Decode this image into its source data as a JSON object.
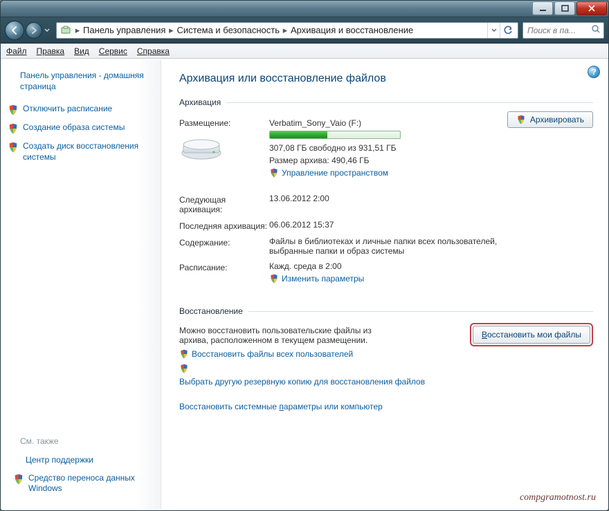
{
  "breadcrumbs": {
    "b0": "Панель управления",
    "b1": "Система и безопасность",
    "b2": "Архивация и восстановление"
  },
  "search": {
    "placeholder": "Поиск в па..."
  },
  "menu": {
    "file": "Файл",
    "edit": "Правка",
    "view": "Вид",
    "tools": "Сервис",
    "help": "Справка"
  },
  "sidebar": {
    "home": "Панель управления - домашняя страница",
    "disable_schedule": "Отключить расписание",
    "create_image": "Создание образа системы",
    "create_repair": "Создать диск восстановления системы",
    "also": "См. также",
    "support": "Центр поддержки",
    "wet": "Средство переноса данных Windows"
  },
  "main": {
    "title": "Архивация или восстановление файлов",
    "backup_section": "Архивация",
    "loc_label": "Размещение:",
    "loc_value": "Verbatim_Sony_Vaio (F:)",
    "free_space": "307,08 ГБ свободно из 931,51 ГБ",
    "archive_size": "Размер архива: 490,46 ГБ",
    "manage_space": "Управление пространством",
    "backup_btn": "Архивировать",
    "next_label": "Следующая архивация:",
    "next_value": "13.06.2012 2:00",
    "last_label": "Последняя архивация:",
    "last_value": "06.06.2012 15:37",
    "content_label": "Содержание:",
    "content_value": "Файлы в библиотеках и личные папки всех пользователей, выбранные папки и образ системы",
    "schedule_label": "Расписание:",
    "schedule_value": "Кажд. среда в 2:00",
    "change_params": "Изменить параметры",
    "restore_section": "Восстановление",
    "restore_desc": "Можно восстановить пользовательские файлы из архива, расположенном в текущем размещении.",
    "restore_btn_pre": "В",
    "restore_btn_rest": "осстановить мои файлы",
    "restore_all": "Восстановить файлы всех пользователей",
    "choose_other": "Выбрать другую резервную копию для восстановления файлов",
    "restore_sys_pre": "Восстановить системные ",
    "restore_sys_u": "п",
    "restore_sys_rest": "араметры или компьютер"
  },
  "watermark": "compgramotnost.ru"
}
